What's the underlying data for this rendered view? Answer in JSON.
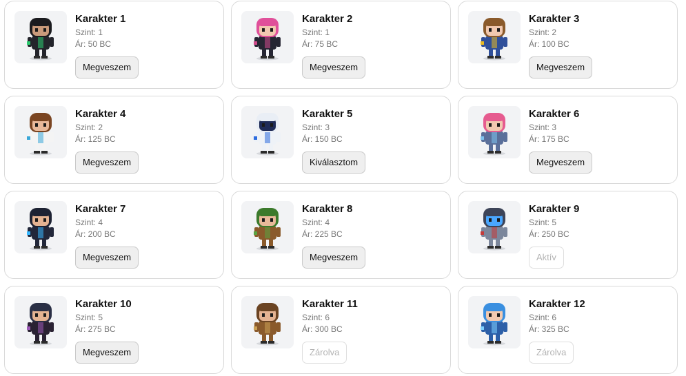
{
  "characters": [
    {
      "name": "Karakter 1",
      "level": "Szint: 1",
      "price": "Ár: 50 BC",
      "button": "Megveszem",
      "disabled": false,
      "icon": "hooded-hacker-character-icon",
      "colors": {
        "hair": "#1b1b1f",
        "skin": "#c99a7b",
        "body": "#23242b",
        "accent": "#2ecc71"
      }
    },
    {
      "name": "Karakter 2",
      "level": "Szint: 1",
      "price": "Ár: 75 BC",
      "button": "Megveszem",
      "disabled": false,
      "icon": "pink-hair-girl-character-icon",
      "colors": {
        "hair": "#e0509a",
        "skin": "#f1c9b0",
        "body": "#262633",
        "accent": "#d04b8c"
      }
    },
    {
      "name": "Karakter 3",
      "level": "Szint: 2",
      "price": "Ár: 100 BC",
      "button": "Megveszem",
      "disabled": false,
      "icon": "wizard-character-icon",
      "colors": {
        "hair": "#8a5a2b",
        "skin": "#f1c9b0",
        "body": "#2f4f9a",
        "accent": "#e8b923"
      }
    },
    {
      "name": "Karakter 4",
      "level": "Szint: 2",
      "price": "Ár: 125 BC",
      "button": "Megveszem",
      "disabled": false,
      "icon": "scientist-character-icon",
      "colors": {
        "hair": "#7a4522",
        "skin": "#e9b99a",
        "body": "#f4f4f4",
        "accent": "#3aa7d8"
      }
    },
    {
      "name": "Karakter 5",
      "level": "Szint: 3",
      "price": "Ár: 150 BC",
      "button": "Kiválasztom",
      "disabled": false,
      "icon": "astronaut-character-icon",
      "colors": {
        "hair": "#e9eef5",
        "skin": "#1f2b57",
        "body": "#eef2f7",
        "accent": "#2d6cdf"
      }
    },
    {
      "name": "Karakter 6",
      "level": "Szint: 3",
      "price": "Ár: 175 BC",
      "button": "Megveszem",
      "disabled": false,
      "icon": "pink-pigtails-girl-character-icon",
      "colors": {
        "hair": "#e65b8f",
        "skin": "#f1c9b0",
        "body": "#5a6f9a",
        "accent": "#7fc3ee"
      }
    },
    {
      "name": "Karakter 7",
      "level": "Szint: 4",
      "price": "Ár: 200 BC",
      "button": "Megveszem",
      "disabled": false,
      "icon": "cyber-visor-character-icon",
      "colors": {
        "hair": "#1d2233",
        "skin": "#e4b392",
        "body": "#22273a",
        "accent": "#39b8ff"
      }
    },
    {
      "name": "Karakter 8",
      "level": "Szint: 4",
      "price": "Ár: 225 BC",
      "button": "Megveszem",
      "disabled": false,
      "icon": "elf-archer-character-icon",
      "colors": {
        "hair": "#3c7a2c",
        "skin": "#e9b99a",
        "body": "#8a5a2b",
        "accent": "#5aa342"
      }
    },
    {
      "name": "Karakter 9",
      "level": "Szint: 5",
      "price": "Ár: 250 BC",
      "button": "Aktív",
      "disabled": true,
      "icon": "robot-knight-character-icon",
      "colors": {
        "hair": "#3d4458",
        "skin": "#4aa7ff",
        "body": "#7c879c",
        "accent": "#c43a3a"
      }
    },
    {
      "name": "Karakter 10",
      "level": "Szint: 5",
      "price": "Ár: 275 BC",
      "button": "Megveszem",
      "disabled": false,
      "icon": "headphones-girl-character-icon",
      "colors": {
        "hair": "#2a2f45",
        "skin": "#e4b392",
        "body": "#2a2233",
        "accent": "#9b59b6"
      }
    },
    {
      "name": "Karakter 11",
      "level": "Szint: 6",
      "price": "Ár: 300 BC",
      "button": "Zárolva",
      "disabled": true,
      "icon": "steampunk-character-icon",
      "colors": {
        "hair": "#6b4423",
        "skin": "#e4b392",
        "body": "#8a5a2b",
        "accent": "#caa055"
      }
    },
    {
      "name": "Karakter 12",
      "level": "Szint: 6",
      "price": "Ár: 325 BC",
      "button": "Zárolva",
      "disabled": true,
      "icon": "blue-mage-character-icon",
      "colors": {
        "hair": "#3a8fe0",
        "skin": "#f1c9b0",
        "body": "#2c5fa8",
        "accent": "#7fd0ff"
      }
    }
  ]
}
